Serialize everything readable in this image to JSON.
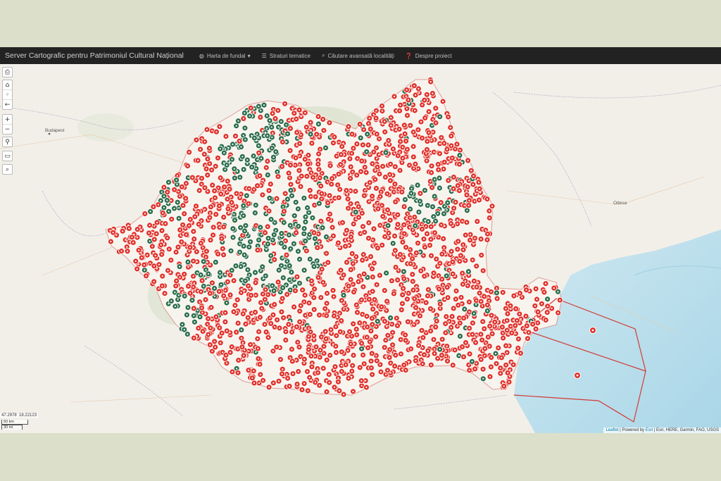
{
  "navbar": {
    "brand": "Server Cartografic pentru Patrimoniul Cultural Național",
    "items": [
      {
        "icon": "globe-icon",
        "glyph": "◍",
        "label": "Harta de fundal",
        "caret": "▾"
      },
      {
        "icon": "list-icon",
        "glyph": "☰",
        "label": "Straturi tematice",
        "caret": ""
      },
      {
        "icon": "search-icon",
        "glyph": "⌕",
        "label": "Căutare avansată localități",
        "caret": ""
      },
      {
        "icon": "question-icon",
        "glyph": "❓",
        "label": "Despre proiect",
        "caret": ""
      }
    ]
  },
  "controls": {
    "print": "⎙",
    "home": "⌂",
    "locate": "⌖",
    "back": "←",
    "zoom_in": "+",
    "zoom_out": "−",
    "marker": "⚲",
    "draw": "▭",
    "search": "⌕"
  },
  "coords": {
    "lat": "47.2978",
    "lng": "18.22123"
  },
  "scale": {
    "km": "50 km",
    "mi": "30 mi"
  },
  "attribution": {
    "leaflet": "Leaflet",
    "powered": " | Powered by ",
    "esri": "Esri",
    "rest": " | Esri, HERE, Garmin, FAO, USGS"
  },
  "places": {
    "budapest": "Budapest",
    "odesa": "Odesa"
  },
  "colors": {
    "red_marker": "#e0332c",
    "green_marker": "#2e6e4c",
    "sea": "#bfe0ec",
    "land": "#f2efe9",
    "border": "#d33a34"
  }
}
